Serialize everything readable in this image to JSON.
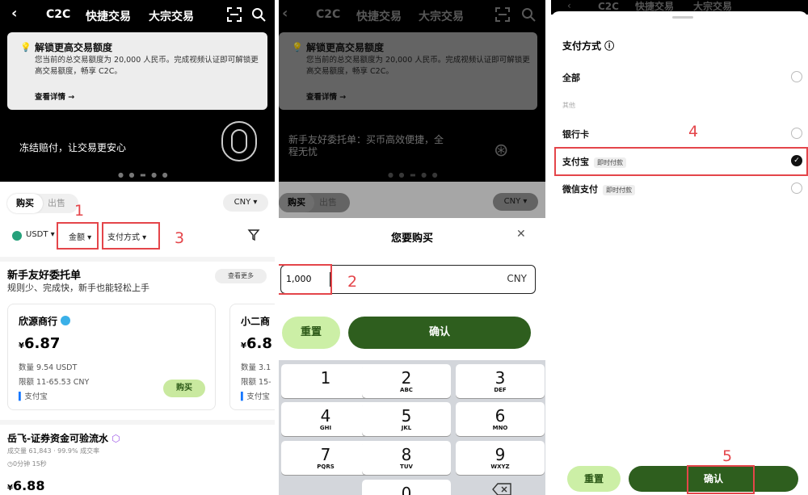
{
  "colors": {
    "brand_dark": "#2e5e1e",
    "brand_light": "#c9e99f",
    "annotation": "#e4454a"
  },
  "p1": {
    "nav": {
      "back": "‹",
      "c2c": "C2C",
      "quick": "快捷交易",
      "block": "大宗交易"
    },
    "banner": {
      "title": "解锁更高交易额度",
      "desc": "您当前的总交易额度为 20,000 人民币。完成视频认证即可解锁更高交易额度，畅享 C2C。",
      "link": "查看详情 →"
    },
    "slogan": "冻结赔付，让交易更安心",
    "tabs": {
      "buy": "购买",
      "sell": "出售"
    },
    "currency": "CNY ▾",
    "filters": {
      "coin": "USDT ▾",
      "amount": "金额 ▾",
      "payment": "支付方式 ▾"
    },
    "section": {
      "title": "新手友好委托单",
      "subtitle": "规则少、完成快，新手也能轻松上手",
      "more": "查看更多"
    },
    "card1": {
      "name": "欣源商行",
      "currency_symbol": "¥",
      "price": "6.87",
      "qty": "数量 9.54 USDT",
      "limit": "限额 11-65.53 CNY",
      "pay": "支付宝",
      "buy": "购买"
    },
    "card2": {
      "name": "小二商",
      "currency_symbol": "¥",
      "price": "6.8",
      "qty": "数量 3.1",
      "limit": "限额 15-",
      "pay": "支付宝"
    },
    "merchant": {
      "name": "岳飞-证券资金可验流水",
      "stats": "成交量 61,843 · 99.9% 成交率",
      "time": "0分钟 15秒",
      "currency_symbol": "¥",
      "price": "6.88"
    },
    "annotations": {
      "n1": "1",
      "n3": "3"
    }
  },
  "p2": {
    "nav": {
      "c2c": "C2C",
      "quick": "快捷交易",
      "block": "大宗交易"
    },
    "banner": {
      "title": "解锁更高交易额度",
      "desc": "您当前的总交易额度为 20,000 人民币。完成视频认证即可解锁更高交易额度，畅享 C2C。",
      "link": "查看详情 →"
    },
    "slogan": "新手友好委托单：买币高效便捷，全程无忧",
    "tabs": {
      "buy": "购买",
      "sell": "出售"
    },
    "currency": "CNY ▾",
    "sheet": {
      "title": "您要购买",
      "close": "✕",
      "amount": "1,000",
      "unit": "CNY",
      "reset": "重置",
      "confirm": "确认"
    },
    "keys": [
      {
        "d": "1",
        "t": ""
      },
      {
        "d": "2",
        "t": "ABC"
      },
      {
        "d": "3",
        "t": "DEF"
      },
      {
        "d": "4",
        "t": "GHI"
      },
      {
        "d": "5",
        "t": "JKL"
      },
      {
        "d": "6",
        "t": "MNO"
      },
      {
        "d": "7",
        "t": "PQRS"
      },
      {
        "d": "8",
        "t": "TUV"
      },
      {
        "d": "9",
        "t": "WXYZ"
      },
      {
        "d": "0",
        "t": ""
      }
    ],
    "annotations": {
      "n2": "2"
    }
  },
  "p3": {
    "title": "支付方式 ⓘ",
    "all": "全部",
    "other": "其他",
    "bank": "银行卡",
    "alipay": {
      "label": "支付宝",
      "tag": "即时付款"
    },
    "wechat": {
      "label": "微信支付",
      "tag": "即时付款"
    },
    "reset": "重置",
    "confirm": "确认",
    "annotations": {
      "n4": "4",
      "n5": "5"
    }
  }
}
